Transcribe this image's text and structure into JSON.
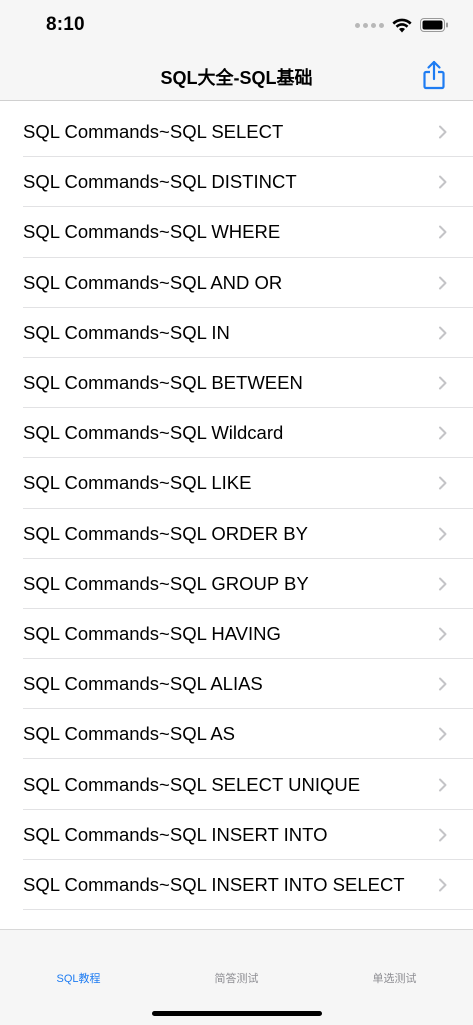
{
  "status_bar": {
    "time": "8:10"
  },
  "nav": {
    "title": "SQL大全-SQL基础",
    "accent_color": "#1e7cf2"
  },
  "list": {
    "items": [
      {
        "label": "SQL Commands~SQL SELECT"
      },
      {
        "label": "SQL Commands~SQL DISTINCT"
      },
      {
        "label": "SQL Commands~SQL WHERE"
      },
      {
        "label": "SQL Commands~SQL AND OR"
      },
      {
        "label": "SQL Commands~SQL IN"
      },
      {
        "label": "SQL Commands~SQL BETWEEN"
      },
      {
        "label": "SQL Commands~SQL Wildcard"
      },
      {
        "label": "SQL Commands~SQL LIKE"
      },
      {
        "label": "SQL Commands~SQL ORDER BY"
      },
      {
        "label": "SQL Commands~SQL GROUP BY"
      },
      {
        "label": "SQL Commands~SQL HAVING"
      },
      {
        "label": "SQL Commands~SQL ALIAS"
      },
      {
        "label": "SQL Commands~SQL AS"
      },
      {
        "label": "SQL Commands~SQL SELECT UNIQUE"
      },
      {
        "label": "SQL Commands~SQL INSERT INTO"
      },
      {
        "label": "SQL Commands~SQL INSERT INTO SELECT"
      }
    ]
  },
  "tabs": [
    {
      "label": "SQL教程",
      "active": true
    },
    {
      "label": "简答测试",
      "active": false
    },
    {
      "label": "单选测试",
      "active": false
    }
  ]
}
